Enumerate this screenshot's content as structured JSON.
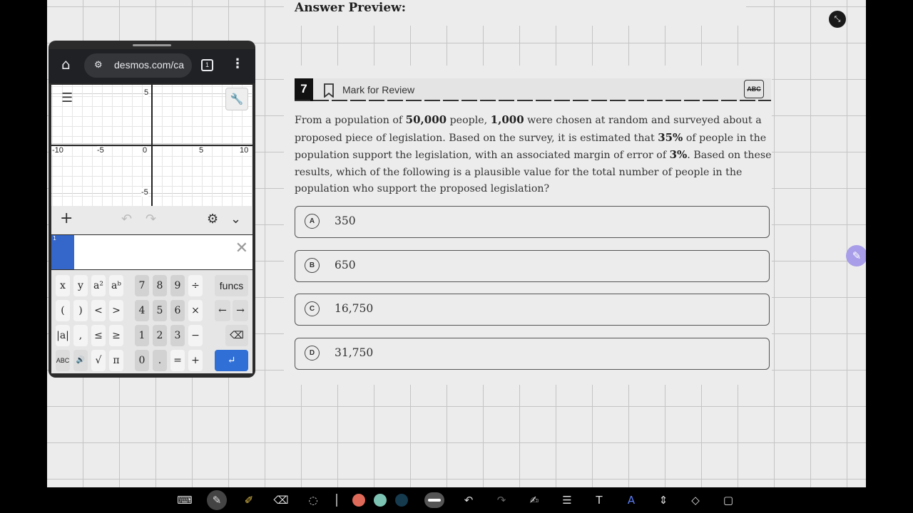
{
  "page": {
    "answer_preview": "Answer Preview:",
    "question": {
      "number": "7",
      "mark_for_review": "Mark for Review",
      "abc_label": "ABC",
      "text_parts": [
        "From a population of ",
        "50,000",
        " people, ",
        "1,000",
        " were chosen at random and surveyed about a proposed piece of legislation. Based on the survey, it is estimated that ",
        "35%",
        " of people in the population support the legislation, with an associated margin of error of ",
        "3%",
        ". Based on these results, which of the following is a plausible value for the total number of people in the population who support the proposed legislation?"
      ],
      "options": [
        {
          "letter": "A",
          "text": "350"
        },
        {
          "letter": "B",
          "text": "650"
        },
        {
          "letter": "C",
          "text": "16,750"
        },
        {
          "letter": "D",
          "text": "31,750"
        }
      ]
    }
  },
  "browser": {
    "url": "desmos.com/ca",
    "tab_count": "1"
  },
  "desmos": {
    "ticks": {
      "x_neg10": "-10",
      "x_neg5": "-5",
      "zero": "0",
      "x_5": "5",
      "x_10": "10",
      "y_5": "5",
      "y_neg5": "-5"
    },
    "expression_index": "1",
    "keypad": {
      "row1": [
        "x",
        "y",
        "a²",
        "aᵇ",
        "7",
        "8",
        "9",
        "÷",
        "funcs"
      ],
      "row2": [
        "(",
        ")",
        "<",
        ">",
        "4",
        "5",
        "6",
        "×",
        "←",
        "→"
      ],
      "row3": [
        "|a|",
        ",",
        "≤",
        "≥",
        "1",
        "2",
        "3",
        "−",
        "⌫"
      ],
      "row4": [
        "ABC",
        "🔊",
        "√",
        "π",
        "0",
        ".",
        "=",
        "+",
        "↵"
      ]
    }
  },
  "icons": {
    "collapse": "collapse-icon",
    "pen_fab": "pen-icon",
    "colors": {
      "red": "#e06a5a",
      "teal": "#7cc3b3",
      "navy": "#163a4e",
      "accent": "#2f6fd6"
    }
  }
}
